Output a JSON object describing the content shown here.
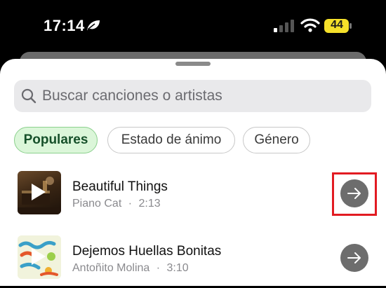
{
  "status_bar": {
    "time": "17:14",
    "battery_level": "44",
    "battery_color": "#f5e02a",
    "icons": [
      "leaf-icon",
      "signal-icon",
      "wifi-icon",
      "battery-icon"
    ]
  },
  "search": {
    "placeholder": "Buscar canciones o artistas",
    "icon": "search-icon"
  },
  "filters": [
    {
      "label": "Populares",
      "selected": true
    },
    {
      "label": "Estado de ánimo",
      "selected": false
    },
    {
      "label": "Género",
      "selected": false
    }
  ],
  "songs": [
    {
      "title": "Beautiful Things",
      "artist": "Piano Cat",
      "separator": "·",
      "duration": "2:13",
      "highlighted": true
    },
    {
      "title": "Dejemos Huellas Bonitas",
      "artist": "Antoñito Molina",
      "separator": "·",
      "duration": "3:10",
      "highlighted": false
    }
  ],
  "colors": {
    "accent_chip_bg": "#dbf6d9",
    "accent_chip_text": "#16502a",
    "highlight_box": "#e21b22"
  }
}
